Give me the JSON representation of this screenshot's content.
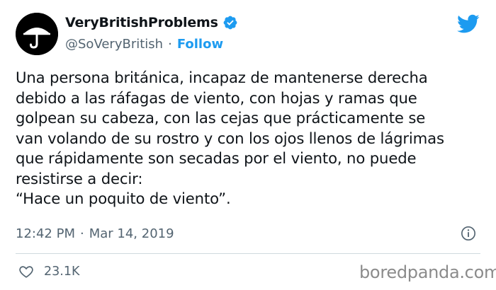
{
  "author": {
    "display_name": "VeryBritishProblems",
    "handle": "@SoVeryBritish",
    "separator": "·",
    "follow_label": "Follow",
    "avatar_icon": "umbrella-icon",
    "verified_icon": "verified-badge-icon"
  },
  "tweet": {
    "lines": [
      "Una persona británica, incapaz de mantenerse derecha",
      "debido a las ráfagas de viento, con hojas y ramas que",
      "golpean su cabeza, con las cejas que prácticamente se",
      "van volando de su rostro y con los ojos llenos de lágrimas",
      "que rápidamente son secadas por el viento, no puede",
      "resistirse a decir:",
      "“Hace un poquito de viento”."
    ]
  },
  "meta": {
    "time": "12:42 PM",
    "separator": "·",
    "date": "Mar 14, 2019"
  },
  "engagement": {
    "likes": "23.1K"
  },
  "watermark": "boredpanda.com",
  "colors": {
    "accent": "#1d9bf0",
    "text": "#0f1419",
    "muted": "#536471",
    "divider": "#cfd9de"
  }
}
